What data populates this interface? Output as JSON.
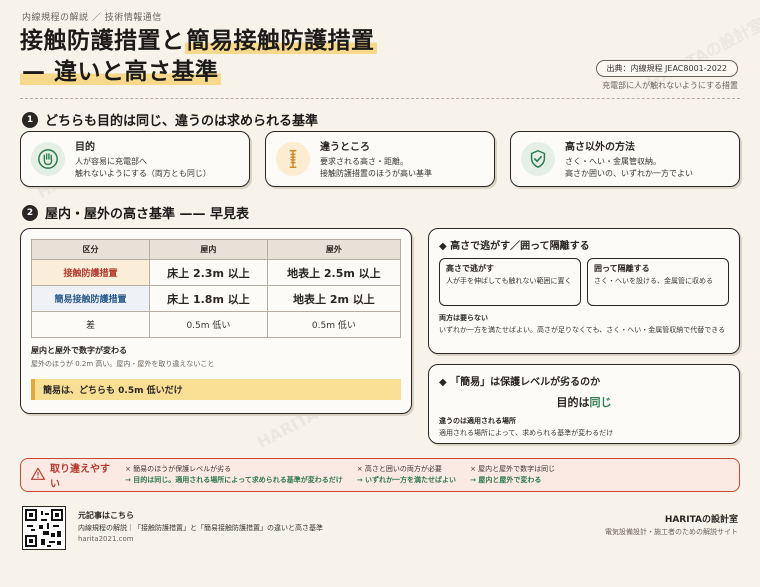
{
  "header": {
    "breadcrumb": "内線規程の解説 ／ 技術情報通信",
    "title_line1_part1": "接触防護措置",
    "title_line1_joiner": "と",
    "title_line1_part2": "簡易接触防護措置",
    "title_line2": "— 違いと高さ基準",
    "source": "出典：内線規程 JEAC8001-2022",
    "source_sub": "充電部に人が触れないようにする措置"
  },
  "section1": {
    "num": "1",
    "title": "どちらも目的は同じ、違うのは求められる基準",
    "cards": [
      {
        "title": "目的",
        "body1": "人が容易に充電部へ",
        "body2": "触れないようにする（両方とも同じ）",
        "color": "#2f7a4f",
        "icon": "hand-stop-icon"
      },
      {
        "title": "違うところ",
        "body1": "要求される高さ・距離。",
        "body2": "接触防護措置のほうが高い基準",
        "color": "#e4a83b",
        "icon": "ruler-icon"
      },
      {
        "title": "高さ以外の方法",
        "body1": "さく・へい・金属管収納。",
        "body2": "高さか囲いの、いずれか一方でよい",
        "color": "#2f7a4f",
        "icon": "shield-check-icon"
      }
    ]
  },
  "section2": {
    "num": "2",
    "title": "屋内・屋外の高さ基準 —— 早見表",
    "table": {
      "headers": [
        "区分",
        "屋内",
        "屋外"
      ],
      "rows": [
        [
          "接触防護措置",
          "床上 2.3m 以上",
          "地表上 2.5m 以上"
        ],
        [
          "簡易接触防護措置",
          "床上 1.8m 以上",
          "地表上 2m 以上"
        ],
        [
          "差",
          "0.5m 低い",
          "0.5m 低い"
        ]
      ]
    },
    "note_title": "屋内と屋外で数字が変わる",
    "note_body": "屋外のほうが 0.2m 高い。屋内・屋外を取り違えないこと",
    "note_strip": "簡易は、どちらも 0.5m 低いだけ"
  },
  "right1": {
    "title": "高さで逃がす／囲って隔離する",
    "box1_title": "高さで逃がす",
    "box1_body": "人が手を伸ばしても触れない範囲に置く",
    "box2_title": "囲って隔離する",
    "box2_body": "さく・へいを設ける、金属管に収める",
    "no_need_title": "両方は要らない",
    "no_need_body": "いずれか一方を満たせばよい。高さが足りなくても、さく・へい・金属管収納で代替できる"
  },
  "right2": {
    "title": "「簡易」は保護レベルが劣るのか",
    "purpose_prefix": "目的は",
    "purpose_same": "同じ",
    "diff_title": "違うのは適用される場所",
    "diff_body": "適用される場所によって、求められる基準が変わるだけ"
  },
  "mistakes": {
    "label": "取り違えやすい",
    "items": [
      {
        "wrong": "× 簡易のほうが保護レベルが劣る",
        "right": "→ 目的は同じ。適用される場所によって求められる基準が変わるだけ"
      },
      {
        "wrong": "× 高さと囲いの両方が必要",
        "right": "→ いずれか一方を満たせばよい"
      },
      {
        "wrong": "× 屋内と屋外で数字は同じ",
        "right": "→ 屋内と屋外で変わる"
      }
    ]
  },
  "footer": {
    "source_title": "元記事はこちら",
    "source_desc": "内線規程の解説｜「接触防護措置」と「簡易接触防護措置」の違いと高さ基準",
    "source_url": "harita2021.com",
    "brand": "HARITAの設計室",
    "brand_sub": "電気設備設計・施工者のための解説サイト",
    "watermark": "HARITAの設計室"
  },
  "colors": {
    "ink": "#2a2623",
    "red": "#b63a2e",
    "blue": "#2d5b8c",
    "green": "#2f7a4f",
    "yellow": "#f9df94"
  }
}
